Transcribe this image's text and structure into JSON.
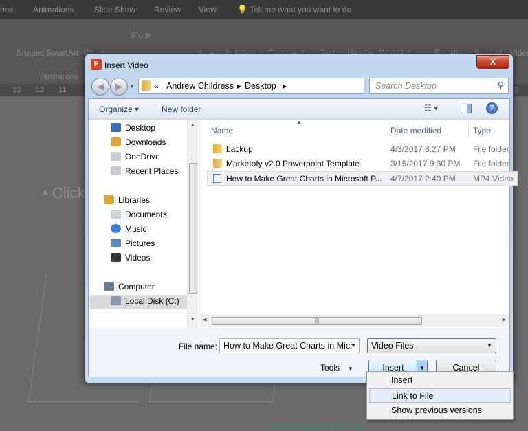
{
  "ribbon_tabs": [
    "ons",
    "Animations",
    "Slide Show",
    "Review",
    "View",
    "Tell me what you want to do"
  ],
  "ribbon_items": [
    "Shapes",
    "SmartArt",
    "Chart",
    "Store",
    "Hyperlink",
    "Action",
    "Comment",
    "Text",
    "Header",
    "WordArt",
    "Equation",
    "Symbol",
    "Video",
    "Illustrations"
  ],
  "ruler": [
    "13",
    "12",
    "11",
    "9"
  ],
  "slide_text": "• Click",
  "dialog": {
    "title": "Insert Video",
    "close": "X",
    "address": {
      "prefix": "«",
      "crumbs": [
        "Andrew Childress",
        "Desktop"
      ]
    },
    "search_placeholder": "Search Desktop",
    "toolbar": {
      "organize": "Organize ▾",
      "new_folder": "New folder"
    },
    "nav": [
      {
        "label": "Desktop",
        "color": "#3a6fb8"
      },
      {
        "label": "Downloads",
        "color": "#d9a83b"
      },
      {
        "label": "OneDrive",
        "color": "#9aa8b8"
      },
      {
        "label": "Recent Places",
        "color": "#9aa8b8"
      },
      {
        "label": "Libraries",
        "color": "#d9a83b"
      },
      {
        "label": "Documents",
        "color": "#c8ccd4"
      },
      {
        "label": "Music",
        "color": "#3a7fd0"
      },
      {
        "label": "Pictures",
        "color": "#5a8ab8"
      },
      {
        "label": "Videos",
        "color": "#333"
      },
      {
        "label": "Computer",
        "color": "#6a7f9a"
      },
      {
        "label": "Local Disk (C:)",
        "color": "#8a9ab0"
      }
    ],
    "columns": [
      "Name",
      "Date modified",
      "Type"
    ],
    "files": [
      {
        "name": "backup",
        "date": "4/3/2017 8:27 PM",
        "type": "File folder"
      },
      {
        "name": "Marketofy v2.0 Powerpoint Template",
        "date": "3/15/2017 9:30 PM",
        "type": "File folder"
      },
      {
        "name": "How to Make Great Charts in Microsoft P...",
        "date": "4/7/2017 2:40 PM",
        "type": "MP4 Video"
      }
    ],
    "file_name_label": "File name:",
    "file_name_value": "How to Make Great Charts in Micr",
    "filter": "Video Files",
    "tools": "Tools",
    "insert": "Insert",
    "cancel": "Cancel"
  },
  "menu": [
    "Insert",
    "Link to File",
    "Show previous versions"
  ],
  "watermark": "www.companyname.com"
}
